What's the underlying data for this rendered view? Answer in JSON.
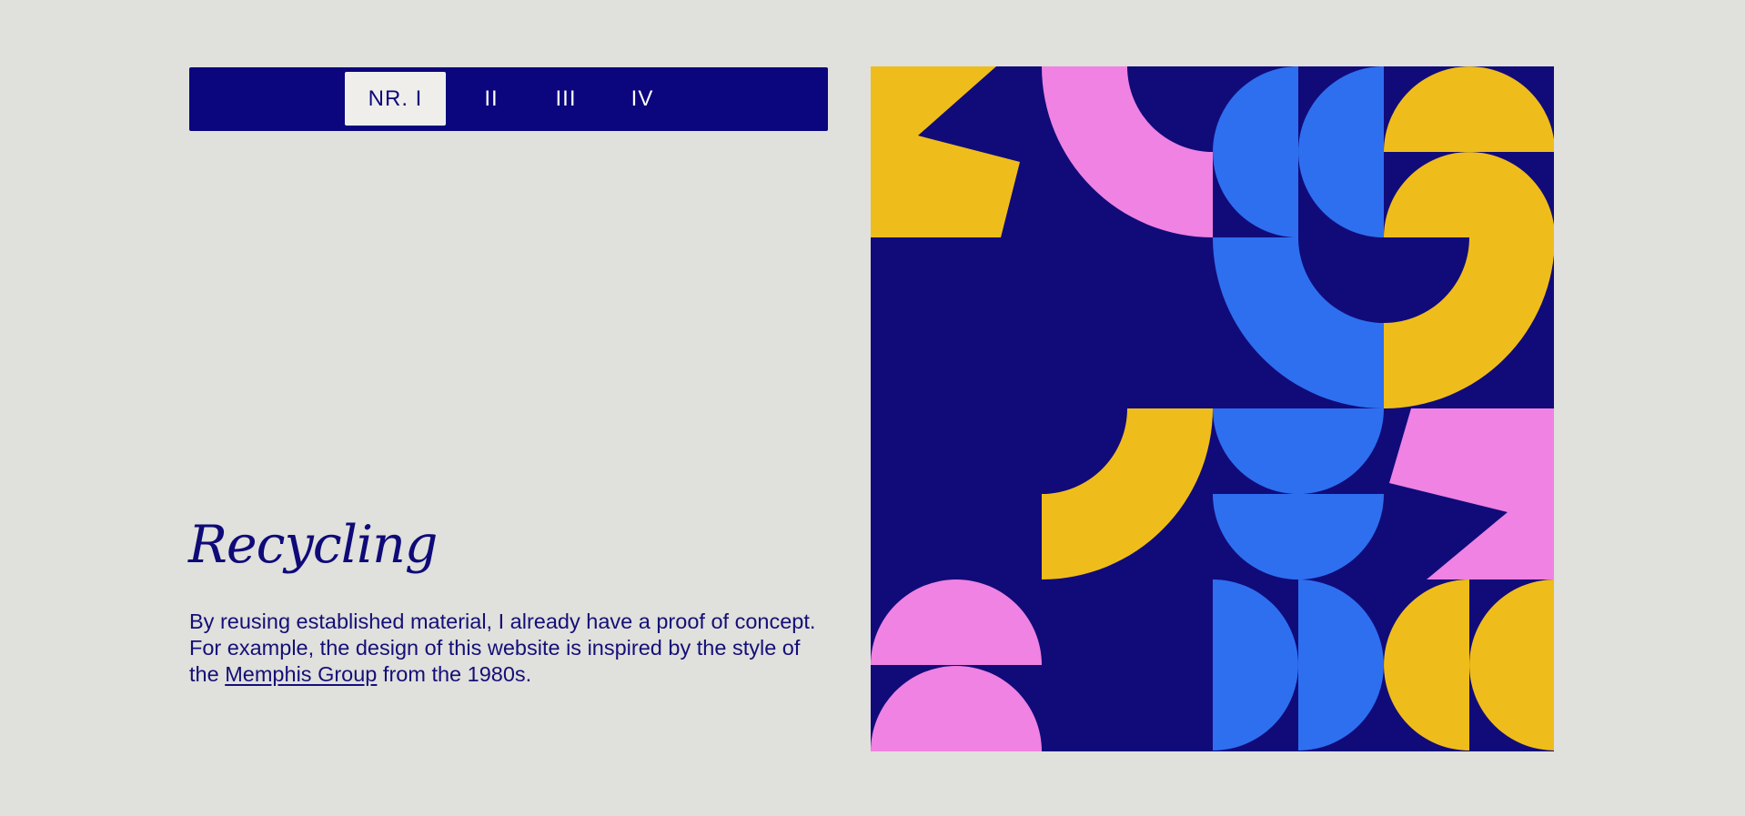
{
  "nav": {
    "tabs": [
      {
        "label": "NR. I",
        "active": true
      },
      {
        "label": "II",
        "active": false
      },
      {
        "label": "III",
        "active": false
      },
      {
        "label": "IV",
        "active": false
      }
    ]
  },
  "section": {
    "title": "Recycling",
    "text_before": "By reusing established material, I already have a proof of concept. For example, the design of this website is inspired by the style of the ",
    "link_text": "Memphis Group",
    "text_after": " from the 1980s."
  },
  "artwork": {
    "palette": {
      "background": "#110b7a",
      "yellow": "#efbd1b",
      "pink": "#ef82e2",
      "blue": "#2e6ff0"
    }
  }
}
